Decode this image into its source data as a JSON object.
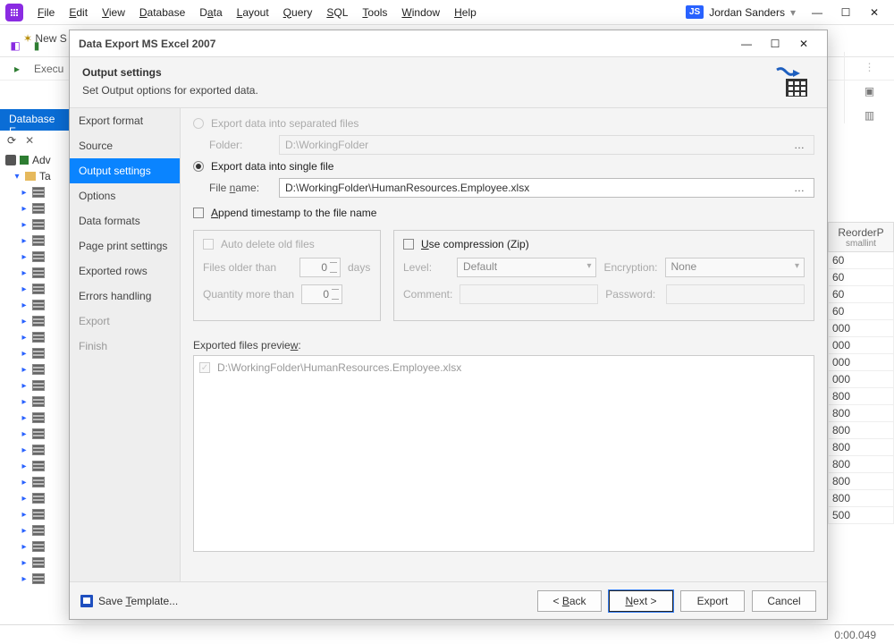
{
  "menus": [
    "File",
    "Edit",
    "View",
    "Database",
    "Data",
    "Layout",
    "Query",
    "SQL",
    "Tools",
    "Window",
    "Help"
  ],
  "user": "Jordan Sanders",
  "user_badge": "JS",
  "tab_label": "New S",
  "sub_toolbar": {
    "exec": "Execu"
  },
  "explorer_title": "Database E",
  "tree": {
    "root": "Adv",
    "branch": "Ta"
  },
  "dialog": {
    "title": "Data Export MS Excel 2007",
    "header_h": "Output settings",
    "header_p": "Set Output options for exported data.",
    "sidebar": [
      "Export format",
      "Source",
      "Output settings",
      "Options",
      "Data formats",
      "Page print settings",
      "Exported rows",
      "Errors handling",
      "Export",
      "Finish"
    ],
    "active_index": 2,
    "dim_from": 8,
    "opt_separated": "Export data into separated files",
    "folder_lbl": "Folder:",
    "folder_val": "D:\\WorkingFolder",
    "opt_single": "Export data into single file",
    "file_lbl": "File name:",
    "file_val": "D:\\WorkingFolder\\HumanResources.Employee.xlsx",
    "append_ts": "Append timestamp to the file name",
    "autodel": "Auto delete old files",
    "older": "Files older than",
    "days": "days",
    "qty": "Quantity more than",
    "spin_default": "0",
    "usezip": "Use compression (Zip)",
    "level": "Level:",
    "level_v": "Default",
    "enc": "Encryption:",
    "enc_v": "None",
    "comment": "Comment:",
    "pass": "Password:",
    "preview_h": "Exported files preview:",
    "preview_item": "D:\\WorkingFolder\\HumanResources.Employee.xlsx",
    "save_tmpl": "Save Template...",
    "back": "< Back",
    "next": "Next >",
    "export": "Export",
    "cancel": "Cancel"
  },
  "grid": {
    "col": "ReorderP",
    "type": "smallint",
    "cells": [
      "60",
      "60",
      "60",
      "60",
      "000",
      "000",
      "000",
      "000",
      "800",
      "800",
      "800",
      "800",
      "800",
      "800",
      "800",
      "500"
    ]
  },
  "status_time": "0:00.049"
}
